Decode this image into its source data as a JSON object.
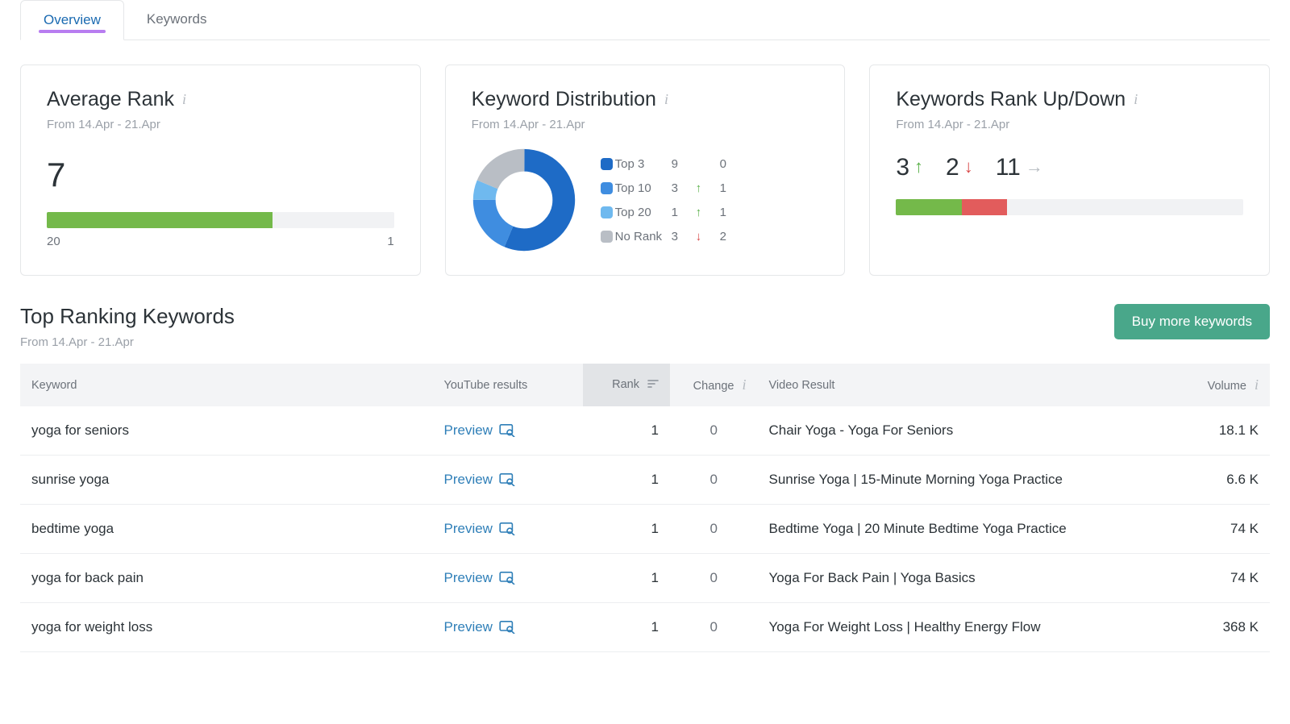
{
  "tabs": [
    {
      "label": "Overview",
      "active": true
    },
    {
      "label": "Keywords",
      "active": false
    }
  ],
  "cards": {
    "avg_rank": {
      "title": "Average Rank",
      "sub": "From 14.Apr - 21.Apr",
      "value": "7",
      "scale_left": "20",
      "scale_right": "1",
      "fill_pct": 65
    },
    "dist": {
      "title": "Keyword Distribution",
      "sub": "From 14.Apr - 21.Apr",
      "rows": [
        {
          "label": "Top 3",
          "count": "9",
          "dir": "",
          "delta": "0",
          "swatch": "sw-top3"
        },
        {
          "label": "Top 10",
          "count": "3",
          "dir": "up",
          "delta": "1",
          "swatch": "sw-top10"
        },
        {
          "label": "Top 20",
          "count": "1",
          "dir": "up",
          "delta": "1",
          "swatch": "sw-top20"
        },
        {
          "label": "No Rank",
          "count": "3",
          "dir": "down",
          "delta": "2",
          "swatch": "sw-norank"
        }
      ]
    },
    "updown": {
      "title": "Keywords Rank Up/Down",
      "sub": "From 14.Apr - 21.Apr",
      "up": "3",
      "down": "2",
      "flat": "11",
      "bar": {
        "green_pct": 19,
        "red_pct": 13
      }
    }
  },
  "section": {
    "title": "Top Ranking Keywords",
    "sub": "From 14.Apr - 21.Apr",
    "buy_btn": "Buy more keywords"
  },
  "table": {
    "headers": {
      "keyword": "Keyword",
      "yt": "YouTube results",
      "rank": "Rank",
      "change": "Change",
      "video": "Video Result",
      "volume": "Volume"
    },
    "preview_label": "Preview",
    "rows": [
      {
        "keyword": "yoga for seniors",
        "rank": "1",
        "change": "0",
        "video": "Chair Yoga - Yoga For Seniors",
        "volume": "18.1 K"
      },
      {
        "keyword": "sunrise yoga",
        "rank": "1",
        "change": "0",
        "video": "Sunrise Yoga | 15-Minute Morning Yoga Practice",
        "volume": "6.6 K"
      },
      {
        "keyword": "bedtime yoga",
        "rank": "1",
        "change": "0",
        "video": "Bedtime Yoga | 20 Minute Bedtime Yoga Practice",
        "volume": "74 K"
      },
      {
        "keyword": "yoga for back pain",
        "rank": "1",
        "change": "0",
        "video": "Yoga For Back Pain | Yoga Basics",
        "volume": "74 K"
      },
      {
        "keyword": "yoga for weight loss",
        "rank": "1",
        "change": "0",
        "video": "Yoga For Weight Loss | Healthy Energy Flow",
        "volume": "368 K"
      }
    ]
  },
  "chart_data": {
    "type": "pie",
    "title": "Keyword Distribution",
    "series": [
      {
        "name": "Top 3",
        "value": 9,
        "color": "#1e6bc6"
      },
      {
        "name": "Top 10",
        "value": 3,
        "color": "#3f8de0"
      },
      {
        "name": "Top 20",
        "value": 1,
        "color": "#6fb9ef"
      },
      {
        "name": "No Rank",
        "value": 3,
        "color": "#b9bec5"
      }
    ]
  }
}
